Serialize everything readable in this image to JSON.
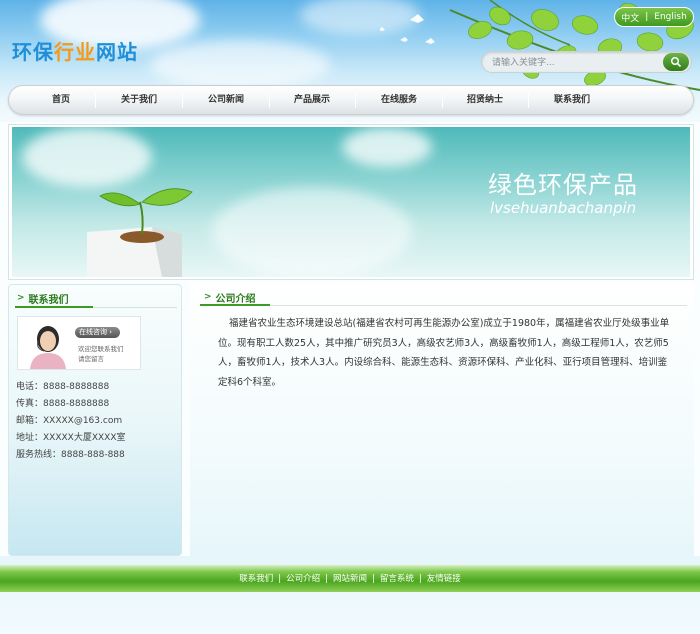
{
  "header": {
    "logo_part1": "环保",
    "logo_part2": "行业",
    "logo_part3": "网站",
    "lang_cn": "中文",
    "lang_sep": "|",
    "lang_en": "English",
    "search_placeholder": "请输入关键字...",
    "search_icon": "magnifier-icon"
  },
  "nav": {
    "items": [
      "首页",
      "关于我们",
      "公司新闻",
      "产品展示",
      "在线服务",
      "招贤纳士",
      "联系我们"
    ]
  },
  "banner": {
    "title": "绿色环保产品",
    "subtitle": "lvsehuanbachanpin"
  },
  "sidebar": {
    "title": "联系我们",
    "consult_button": "在线咨询",
    "consult_line1": "欢迎您联系我们",
    "consult_line2": "请您留言",
    "contacts": [
      "电话：8888-8888888",
      "传真：8888-8888888",
      "邮箱：XXXXX@163.com",
      "地址：XXXXX大厦XXXX室",
      "服务热线：8888-888-888"
    ]
  },
  "main": {
    "title": "公司介绍",
    "text": "福建省农业生态环境建设总站(福建省农村可再生能源办公室)成立于1980年，属福建省农业厅处级事业单位。现有职工人数25人，其中推广研究员3人，高级农艺师3人，高级畜牧师1人，高级工程师1人，农艺师5人，畜牧师1人，技术人3人。内设综合科、能源生态科、资源环保科、产业化科、亚行项目管理科、培训鉴定科6个科室。"
  },
  "footer": {
    "links": [
      "联系我们",
      "公司介绍",
      "网站新闻",
      "留言系统",
      "友情链接"
    ],
    "separator": "|"
  },
  "colors": {
    "brand_green": "#3d9a22",
    "logo_blue": "#1f8fd8",
    "logo_orange": "#f49a1b",
    "banner_teal": "#4fb9ba"
  }
}
